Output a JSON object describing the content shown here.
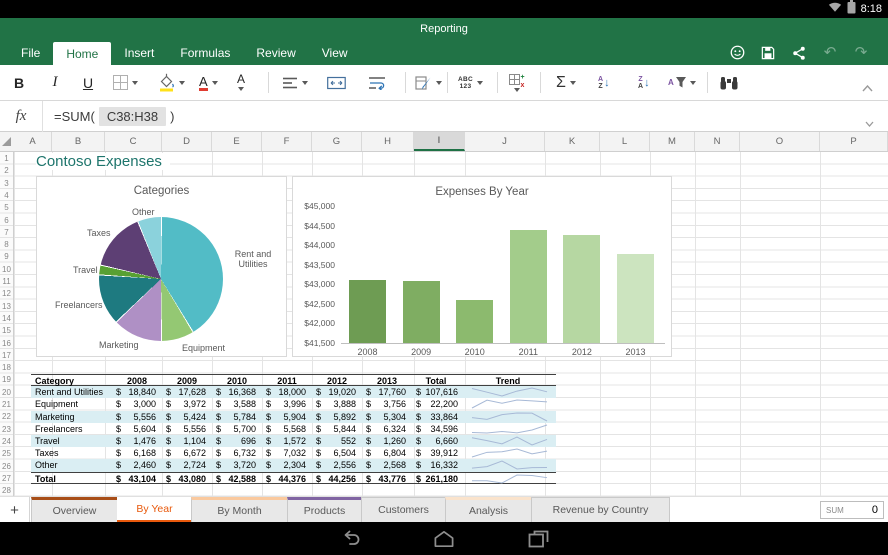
{
  "status_bar": {
    "time": "8:18",
    "icons": [
      "wifi",
      "battery"
    ]
  },
  "title_bar": {
    "title": "Reporting"
  },
  "menu_bar": {
    "tabs": [
      "File",
      "Home",
      "Insert",
      "Formulas",
      "Review",
      "View"
    ],
    "active_tab": "Home",
    "icons": [
      "feedback-smiley",
      "save",
      "share",
      "undo",
      "redo"
    ]
  },
  "toolbar": {
    "bold": "B",
    "italic": "I",
    "underline": "U",
    "font_color_letter": "A",
    "font_size_letter": "A",
    "number_format_top": "ABC",
    "number_format_bottom": "123",
    "sum_symbol": "Σ",
    "sort_az_top": "A",
    "sort_az_bottom": "Z",
    "sort_za_top": "Z",
    "sort_za_bottom": "A",
    "filter_letter": "A"
  },
  "formula_bar": {
    "fx": "fx",
    "prefix": "=SUM(",
    "range": "C38:H38",
    "suffix": ")"
  },
  "grid": {
    "columns": [
      "A",
      "B",
      "C",
      "D",
      "E",
      "F",
      "G",
      "H",
      "I",
      "J",
      "K",
      "L",
      "M",
      "N",
      "O",
      "P"
    ],
    "selected_column": "I",
    "row_numbers": [
      "1",
      "2",
      "3",
      "4",
      "5",
      "6",
      "7",
      "8",
      "9",
      "10",
      "11",
      "12",
      "13",
      "14",
      "15",
      "16",
      "17",
      "18",
      "19",
      "20",
      "21",
      "22",
      "23",
      "24",
      "25",
      "26",
      "27",
      "28"
    ],
    "sheet_title": "Contoso Expenses"
  },
  "chart_data": [
    {
      "type": "pie",
      "title": "Categories",
      "labels": [
        "Rent and Utilities",
        "Equipment",
        "Marketing",
        "Freelancers",
        "Travel",
        "Taxes",
        "Other"
      ],
      "values": [
        107616,
        22200,
        33864,
        34596,
        6660,
        39912,
        16332
      ],
      "colors": [
        "#52BCC6",
        "#94C873",
        "#AF90C5",
        "#1E7A80",
        "#58A033",
        "#5D3F74",
        "#8BD2DC"
      ]
    },
    {
      "type": "bar",
      "title": "Expenses By Year",
      "categories": [
        "2008",
        "2009",
        "2010",
        "2011",
        "2012",
        "2013"
      ],
      "values": [
        43104,
        43080,
        42588,
        44376,
        44256,
        43776
      ],
      "colors": [
        "#6E9C53",
        "#7FAD62",
        "#8CBA6E",
        "#A3CC8B",
        "#B6D7A2",
        "#CCE4BF"
      ],
      "y_ticks": [
        "$45,000",
        "$44,500",
        "$44,000",
        "$43,500",
        "$43,000",
        "$42,500",
        "$42,000",
        "$41,500"
      ],
      "ylim": [
        41500,
        45000
      ]
    }
  ],
  "table": {
    "headers": [
      "Category",
      "2008",
      "2009",
      "2010",
      "2011",
      "2012",
      "2013",
      "Total",
      "Trend"
    ],
    "currency": "$",
    "rows": [
      {
        "category": "Rent and Utilities",
        "values": [
          "18,840",
          "17,628",
          "16,368",
          "18,000",
          "19,020",
          "17,760"
        ],
        "total": "107,616"
      },
      {
        "category": "Equipment",
        "values": [
          "3,000",
          "3,972",
          "3,588",
          "3,996",
          "3,888",
          "3,756"
        ],
        "total": "22,200"
      },
      {
        "category": "Marketing",
        "values": [
          "5,556",
          "5,424",
          "5,784",
          "5,904",
          "5,892",
          "5,304"
        ],
        "total": "33,864"
      },
      {
        "category": "Freelancers",
        "values": [
          "5,604",
          "5,556",
          "5,700",
          "5,568",
          "5,844",
          "6,324"
        ],
        "total": "34,596"
      },
      {
        "category": "Travel",
        "values": [
          "1,476",
          "1,104",
          "696",
          "1,572",
          "552",
          "1,260"
        ],
        "total": "6,660"
      },
      {
        "category": "Taxes",
        "values": [
          "6,168",
          "6,672",
          "6,732",
          "7,032",
          "6,504",
          "6,804"
        ],
        "total": "39,912"
      },
      {
        "category": "Other",
        "values": [
          "2,460",
          "2,724",
          "3,720",
          "2,304",
          "2,556",
          "2,568"
        ],
        "total": "16,332"
      },
      {
        "category": "Total",
        "values": [
          "43,104",
          "43,080",
          "42,588",
          "44,376",
          "44,256",
          "43,776"
        ],
        "total": "261,180"
      }
    ]
  },
  "sheet_tabs": {
    "add_button": "+",
    "tabs": [
      {
        "label": "Overview",
        "stripe": "#A84E18",
        "active": false
      },
      {
        "label": "By Year",
        "stripe": "",
        "active": true
      },
      {
        "label": "By Month",
        "stripe": "#FAC99E",
        "active": false
      },
      {
        "label": "Products",
        "stripe": "#8064A2",
        "active": false
      },
      {
        "label": "Customers",
        "stripe": "",
        "active": false
      },
      {
        "label": "Analysis",
        "stripe": "#FAE3CC",
        "active": false
      },
      {
        "label": "Revenue by Country",
        "stripe": "",
        "active": false
      }
    ],
    "status": {
      "label": "SUM",
      "value": "0"
    }
  },
  "nav_bar": {
    "icons": [
      "back",
      "home",
      "recents"
    ]
  },
  "colors": {
    "excel_green": "#217346",
    "active_sheet_orange": "#E8590C",
    "band_teal": "#DAEEF3",
    "sheet_title_teal": "#1E756C",
    "sparkline": "#A7B9D6"
  }
}
